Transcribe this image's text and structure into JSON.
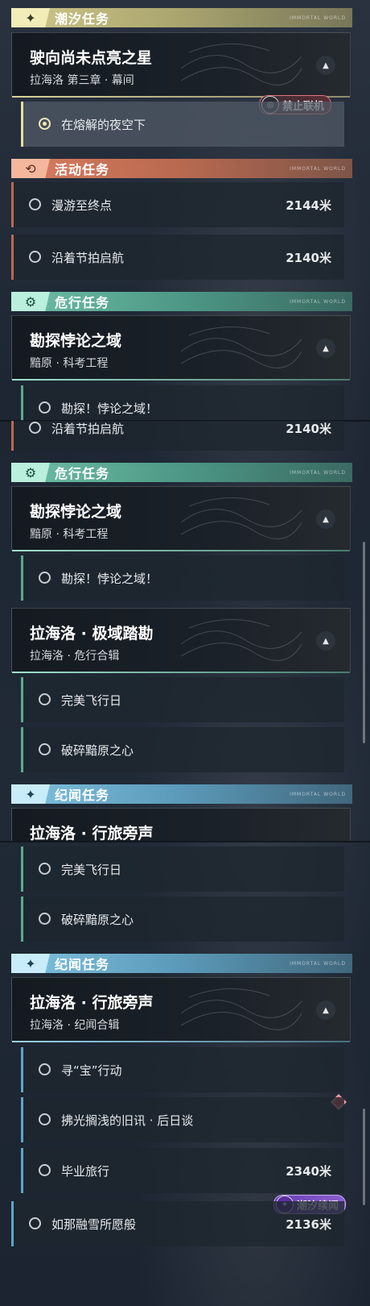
{
  "categories": {
    "tide": "潮汐任务",
    "event": "活动任务",
    "danger": "危行任务",
    "lore": "纪闻任务"
  },
  "quests": {
    "star": {
      "title": "驶向尚未点亮之星",
      "subtitle": "拉海洛 第三章 · 幕间"
    },
    "paradox": {
      "title": "勘探悖论之域",
      "subtitle": "黯原 · 科考工程"
    },
    "polar": {
      "title": "拉海洛 · 极域踏勘",
      "subtitle": "拉海洛 · 危行合辑"
    },
    "travel": {
      "title": "拉海洛 · 行旅旁声",
      "subtitle": "拉海洛 · 纪闻合辑"
    }
  },
  "objectives": {
    "night_sky": "在熔解的夜空下",
    "roam_end": {
      "label": "漫游至终点",
      "distance": "2144米"
    },
    "sail_beat": {
      "label": "沿着节拍启航",
      "distance": "2140米"
    },
    "explore_paradox": "勘探！悖论之域！",
    "perfect_flight": "完美飞行日",
    "shatter_heart": "破碎黯原之心",
    "treasure_hunt": "寻“宝”行动",
    "old_news": "拂光搁浅的旧讯 · 后日谈",
    "graduation_trip": {
      "label": "毕业旅行",
      "distance": "2340米"
    },
    "melting_snow": {
      "label": "如那融雪所愿般",
      "distance": "2136米"
    }
  },
  "badges": {
    "no_coop": "禁止联机",
    "tide_lore": "潮汐续闻"
  },
  "tagline": "IMMORTAL WORLD",
  "icons": {
    "tide": "sparkle-icon",
    "event": "refresh-icon",
    "danger": "gear-icon",
    "lore": "sparkle-icon",
    "expand": "chevron-up-icon"
  },
  "colors": {
    "tide": "#cfc78a",
    "event": "#d97c5f",
    "danger": "#6fbfa6",
    "lore": "#7fc3e0",
    "alert": "#e05465"
  }
}
